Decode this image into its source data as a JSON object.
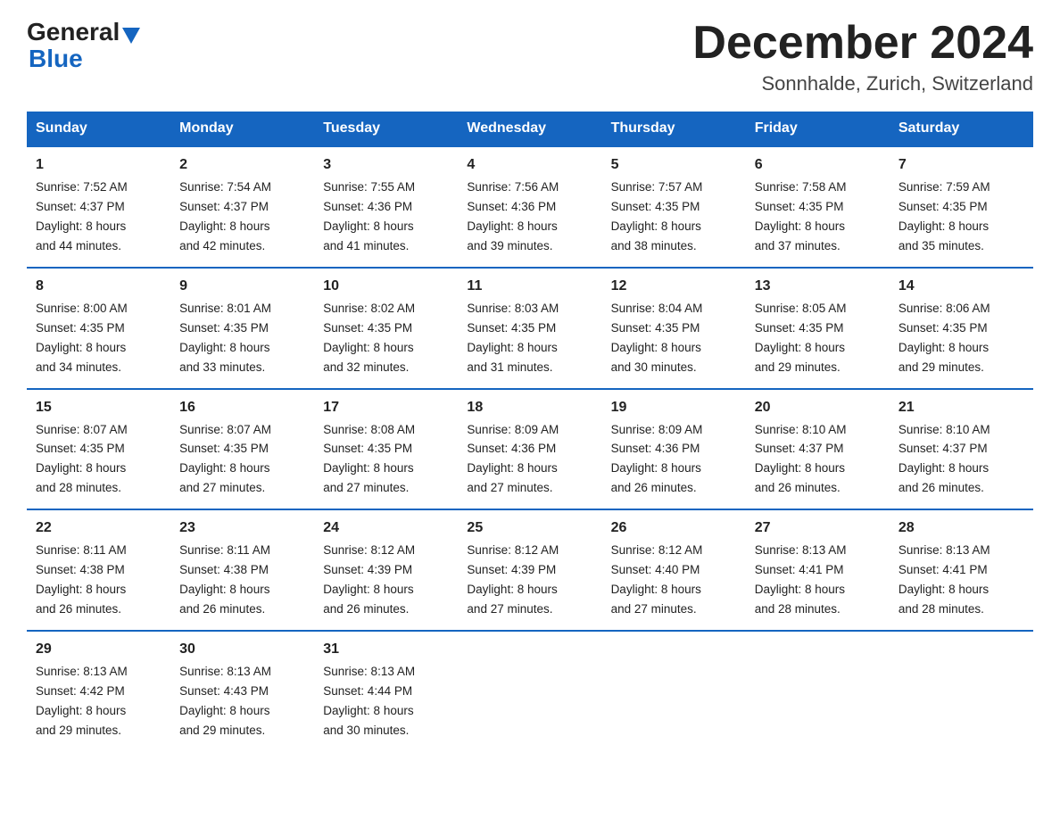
{
  "logo": {
    "text_general": "General",
    "text_blue": "Blue",
    "triangle": "▶"
  },
  "title": "December 2024",
  "subtitle": "Sonnhalde, Zurich, Switzerland",
  "days_of_week": [
    "Sunday",
    "Monday",
    "Tuesday",
    "Wednesday",
    "Thursday",
    "Friday",
    "Saturday"
  ],
  "weeks": [
    [
      {
        "num": "1",
        "sunrise": "7:52 AM",
        "sunset": "4:37 PM",
        "daylight": "8 hours and 44 minutes."
      },
      {
        "num": "2",
        "sunrise": "7:54 AM",
        "sunset": "4:37 PM",
        "daylight": "8 hours and 42 minutes."
      },
      {
        "num": "3",
        "sunrise": "7:55 AM",
        "sunset": "4:36 PM",
        "daylight": "8 hours and 41 minutes."
      },
      {
        "num": "4",
        "sunrise": "7:56 AM",
        "sunset": "4:36 PM",
        "daylight": "8 hours and 39 minutes."
      },
      {
        "num": "5",
        "sunrise": "7:57 AM",
        "sunset": "4:35 PM",
        "daylight": "8 hours and 38 minutes."
      },
      {
        "num": "6",
        "sunrise": "7:58 AM",
        "sunset": "4:35 PM",
        "daylight": "8 hours and 37 minutes."
      },
      {
        "num": "7",
        "sunrise": "7:59 AM",
        "sunset": "4:35 PM",
        "daylight": "8 hours and 35 minutes."
      }
    ],
    [
      {
        "num": "8",
        "sunrise": "8:00 AM",
        "sunset": "4:35 PM",
        "daylight": "8 hours and 34 minutes."
      },
      {
        "num": "9",
        "sunrise": "8:01 AM",
        "sunset": "4:35 PM",
        "daylight": "8 hours and 33 minutes."
      },
      {
        "num": "10",
        "sunrise": "8:02 AM",
        "sunset": "4:35 PM",
        "daylight": "8 hours and 32 minutes."
      },
      {
        "num": "11",
        "sunrise": "8:03 AM",
        "sunset": "4:35 PM",
        "daylight": "8 hours and 31 minutes."
      },
      {
        "num": "12",
        "sunrise": "8:04 AM",
        "sunset": "4:35 PM",
        "daylight": "8 hours and 30 minutes."
      },
      {
        "num": "13",
        "sunrise": "8:05 AM",
        "sunset": "4:35 PM",
        "daylight": "8 hours and 29 minutes."
      },
      {
        "num": "14",
        "sunrise": "8:06 AM",
        "sunset": "4:35 PM",
        "daylight": "8 hours and 29 minutes."
      }
    ],
    [
      {
        "num": "15",
        "sunrise": "8:07 AM",
        "sunset": "4:35 PM",
        "daylight": "8 hours and 28 minutes."
      },
      {
        "num": "16",
        "sunrise": "8:07 AM",
        "sunset": "4:35 PM",
        "daylight": "8 hours and 27 minutes."
      },
      {
        "num": "17",
        "sunrise": "8:08 AM",
        "sunset": "4:35 PM",
        "daylight": "8 hours and 27 minutes."
      },
      {
        "num": "18",
        "sunrise": "8:09 AM",
        "sunset": "4:36 PM",
        "daylight": "8 hours and 27 minutes."
      },
      {
        "num": "19",
        "sunrise": "8:09 AM",
        "sunset": "4:36 PM",
        "daylight": "8 hours and 26 minutes."
      },
      {
        "num": "20",
        "sunrise": "8:10 AM",
        "sunset": "4:37 PM",
        "daylight": "8 hours and 26 minutes."
      },
      {
        "num": "21",
        "sunrise": "8:10 AM",
        "sunset": "4:37 PM",
        "daylight": "8 hours and 26 minutes."
      }
    ],
    [
      {
        "num": "22",
        "sunrise": "8:11 AM",
        "sunset": "4:38 PM",
        "daylight": "8 hours and 26 minutes."
      },
      {
        "num": "23",
        "sunrise": "8:11 AM",
        "sunset": "4:38 PM",
        "daylight": "8 hours and 26 minutes."
      },
      {
        "num": "24",
        "sunrise": "8:12 AM",
        "sunset": "4:39 PM",
        "daylight": "8 hours and 26 minutes."
      },
      {
        "num": "25",
        "sunrise": "8:12 AM",
        "sunset": "4:39 PM",
        "daylight": "8 hours and 27 minutes."
      },
      {
        "num": "26",
        "sunrise": "8:12 AM",
        "sunset": "4:40 PM",
        "daylight": "8 hours and 27 minutes."
      },
      {
        "num": "27",
        "sunrise": "8:13 AM",
        "sunset": "4:41 PM",
        "daylight": "8 hours and 28 minutes."
      },
      {
        "num": "28",
        "sunrise": "8:13 AM",
        "sunset": "4:41 PM",
        "daylight": "8 hours and 28 minutes."
      }
    ],
    [
      {
        "num": "29",
        "sunrise": "8:13 AM",
        "sunset": "4:42 PM",
        "daylight": "8 hours and 29 minutes."
      },
      {
        "num": "30",
        "sunrise": "8:13 AM",
        "sunset": "4:43 PM",
        "daylight": "8 hours and 29 minutes."
      },
      {
        "num": "31",
        "sunrise": "8:13 AM",
        "sunset": "4:44 PM",
        "daylight": "8 hours and 30 minutes."
      },
      null,
      null,
      null,
      null
    ]
  ]
}
